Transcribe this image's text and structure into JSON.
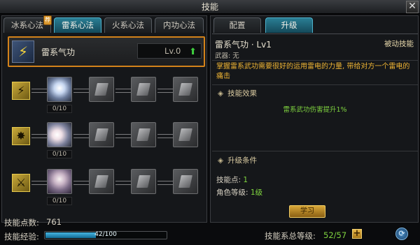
{
  "window": {
    "title": "技能",
    "close_glyph": "✕"
  },
  "left_tabs": [
    {
      "label": "冰系心法",
      "badge": "荐",
      "active": false
    },
    {
      "label": "雷系心法",
      "active": true
    },
    {
      "label": "火系心法",
      "active": false
    },
    {
      "label": "内功心法",
      "active": false
    }
  ],
  "selected_skill": {
    "name": "雷系气功",
    "level": "Lv.0",
    "icon": "lightning-icon"
  },
  "tree_rows": [
    {
      "icon": "thunder-strike-icon",
      "count": "0/10"
    },
    {
      "icon": "thunder-burst-icon",
      "count": "0/10"
    },
    {
      "icon": "thunder-warrior-icon",
      "count": "0/10"
    }
  ],
  "footer": {
    "points_label": "技能点数:",
    "points_value": "761",
    "xp_label": "技能经验:",
    "xp_text": "42/100",
    "xp_fraction": 0.42
  },
  "right_tabs": [
    {
      "label": "配置",
      "active": false
    },
    {
      "label": "升级",
      "active": true
    }
  ],
  "detail": {
    "title": "雷系气功 · Lv1",
    "type": "被动技能",
    "weapon": "武器: 无",
    "description": "掌握雷系武功需要很好的运用雷电的力量, 带给对方一个雷电的痛击",
    "effect_header": "技能效果",
    "effect_text": "雷系武功伤害提升1%",
    "upgrade_header": "升级条件",
    "req_points_label": "技能点:",
    "req_points_value": "1",
    "req_level_label": "角色等级:",
    "req_level_value": "1级",
    "learn_button": "学习"
  },
  "total": {
    "label": "技能系总等级:",
    "value": "52/57"
  },
  "colors": {
    "accent": "#2a7e94",
    "highlight": "#d3821a",
    "green": "#7ed23f"
  }
}
